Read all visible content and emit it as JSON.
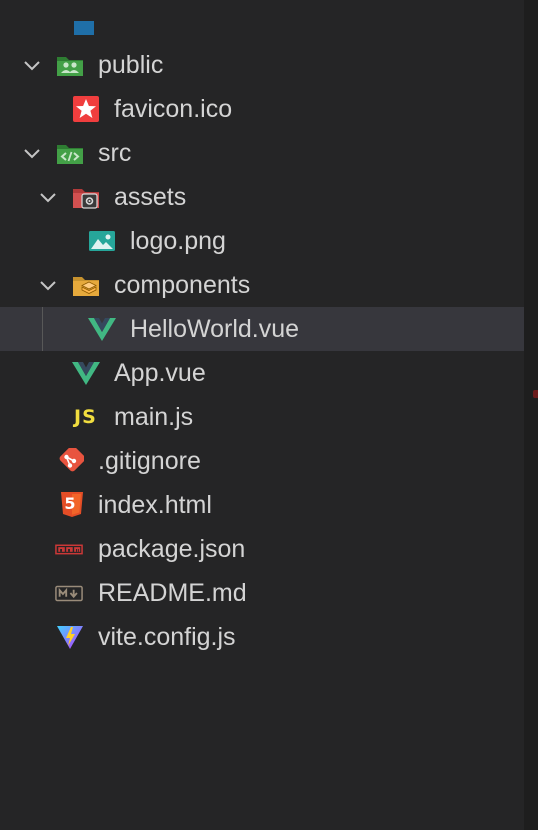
{
  "explorer": {
    "items": [
      {
        "label": "public",
        "type": "folder",
        "expanded": true,
        "icon": "folder-public-icon"
      },
      {
        "label": "favicon.ico",
        "type": "file",
        "icon": "favicon-icon"
      },
      {
        "label": "src",
        "type": "folder",
        "expanded": true,
        "icon": "folder-src-icon"
      },
      {
        "label": "assets",
        "type": "folder",
        "expanded": true,
        "icon": "folder-assets-icon"
      },
      {
        "label": "logo.png",
        "type": "file",
        "icon": "image-icon"
      },
      {
        "label": "components",
        "type": "folder",
        "expanded": true,
        "icon": "folder-components-icon"
      },
      {
        "label": "HelloWorld.vue",
        "type": "file",
        "icon": "vue-icon",
        "selected": true
      },
      {
        "label": "App.vue",
        "type": "file",
        "icon": "vue-icon"
      },
      {
        "label": "main.js",
        "type": "file",
        "icon": "js-icon",
        "icon_text": "JS"
      },
      {
        "label": ".gitignore",
        "type": "file",
        "icon": "git-icon"
      },
      {
        "label": "index.html",
        "type": "file",
        "icon": "html5-icon",
        "icon_text": "5"
      },
      {
        "label": "package.json",
        "type": "file",
        "icon": "npm-icon"
      },
      {
        "label": "README.md",
        "type": "file",
        "icon": "markdown-icon"
      },
      {
        "label": "vite.config.js",
        "type": "file",
        "icon": "vite-icon"
      }
    ]
  },
  "colors": {
    "background": "#252526",
    "selected_row": "#37373d",
    "text": "#d4d4d4",
    "vue_green": "#41b883",
    "js_yellow": "#f1dd3f",
    "html_orange": "#e44d26",
    "git_red": "#e8543f",
    "npm_red": "#cb3837",
    "folder_green": "#4caf50"
  }
}
